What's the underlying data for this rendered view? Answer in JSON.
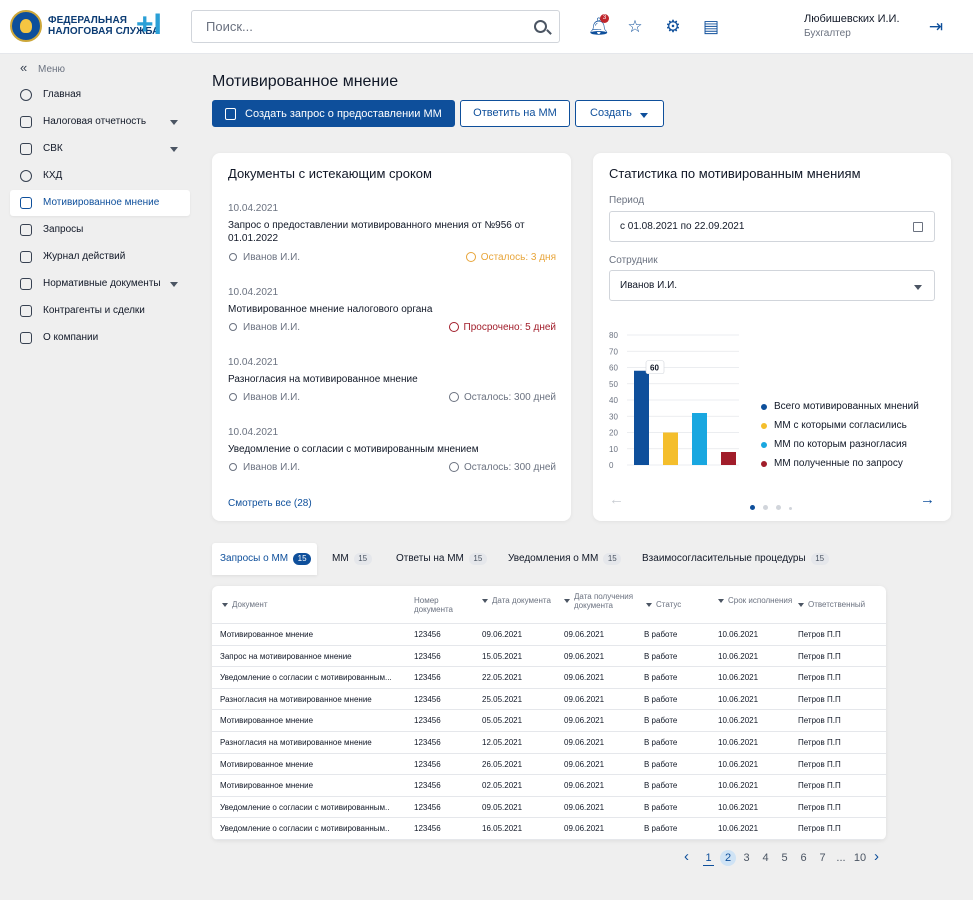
{
  "header": {
    "logo_line1": "ФЕДЕРАЛЬНАЯ",
    "logo_line2": "НАЛОГОВАЯ СЛУЖБА",
    "logo_plus": "+I",
    "search_placeholder": "Поиск...",
    "notifications_count": "3",
    "user_name": "Любишевских И.И.",
    "user_role": "Бухгалтер"
  },
  "sidebar": {
    "menu_label": "Меню",
    "items": [
      {
        "label": "Главная",
        "icon": "home-icon",
        "has_caret": false
      },
      {
        "label": "Налоговая отчетность",
        "icon": "report-icon",
        "has_caret": true
      },
      {
        "label": "СВК",
        "icon": "svk-icon",
        "has_caret": true
      },
      {
        "label": "КХД",
        "icon": "database-icon",
        "has_caret": false
      },
      {
        "label": "Мотивированное мнение",
        "icon": "opinion-icon",
        "has_caret": false
      },
      {
        "label": "Запросы",
        "icon": "inbox-icon",
        "has_caret": false
      },
      {
        "label": "Журнал действий",
        "icon": "journal-icon",
        "has_caret": false
      },
      {
        "label": "Нормативные документы",
        "icon": "docs-icon",
        "has_caret": true
      },
      {
        "label": "Контрагенты и сделки",
        "icon": "contractors-icon",
        "has_caret": false
      },
      {
        "label": "О компании",
        "icon": "info-icon",
        "has_caret": false
      }
    ],
    "active_index": 4
  },
  "page": {
    "title": "Мотивированное мнение",
    "btn_create_request": "Создать запрос о предоставлении ММ",
    "btn_reply": "Ответить на ММ",
    "btn_create": "Создать"
  },
  "expiring": {
    "title": "Документы с истекающим сроком",
    "docs": [
      {
        "date": "10.04.2021",
        "title": "Запрос о предоставлении мотивированного мнения от №956 от 01.01.2022",
        "person": "Иванов И.И.",
        "status": "Осталось: 3 дня",
        "kind": "warn"
      },
      {
        "date": "10.04.2021",
        "title": "Мотивированное мнение налогового органа",
        "person": "Иванов И.И.",
        "status": "Просрочено: 5 дней",
        "kind": "late"
      },
      {
        "date": "10.04.2021",
        "title": "Разногласия на мотивированное мнение",
        "person": "Иванов И.И.",
        "status": "Осталось: 300 дней",
        "kind": "ok"
      },
      {
        "date": "10.04.2021",
        "title": "Уведомление о согласии с мотивированным мнением",
        "person": "Иванов И.И.",
        "status": "Осталось: 300 дней",
        "kind": "ok"
      }
    ],
    "see_all": "Смотреть все (28)"
  },
  "stats": {
    "title": "Статистика по мотивированным мнениям",
    "period_label": "Период",
    "period_value": "с 01.08.2021 по  22.09.2021",
    "employee_label": "Сотрудник",
    "employee_value": "Иванов И.И.",
    "tooltip_value": "60"
  },
  "chart_data": {
    "type": "bar",
    "categories": [
      "Всего мотивированных мнений",
      "ММ с которыми согласились",
      "ММ по которым разногласия",
      "ММ полученные по запросу"
    ],
    "values": [
      58,
      20,
      32,
      8
    ],
    "colors": [
      "#0e4f9b",
      "#f4be2c",
      "#19a7e0",
      "#a11d2a"
    ],
    "yticks": [
      0,
      10,
      20,
      30,
      40,
      50,
      60,
      70,
      80
    ],
    "ylim": [
      0,
      80
    ],
    "legend_placement": "right",
    "grid": true
  },
  "tabs": [
    {
      "label": "Запросы о ММ",
      "count": "15"
    },
    {
      "label": "ММ",
      "count": "15"
    },
    {
      "label": "Ответы на ММ",
      "count": "15"
    },
    {
      "label": "Уведомления о ММ",
      "count": "15"
    },
    {
      "label": "Взаимосогласительные процедуры",
      "count": "15"
    }
  ],
  "table": {
    "headers": [
      "Документ",
      "Номер документа",
      "Дата документа",
      "Дата получения документа",
      "Статус",
      "Срок исполнения",
      "Ответственный"
    ],
    "rows": [
      [
        "Мотивированное мнение",
        "123456",
        "09.06.2021",
        "09.06.2021",
        "В работе",
        "10.06.2021",
        "Петров П.П"
      ],
      [
        "Запрос на мотивированное мнение",
        "123456",
        "15.05.2021",
        "09.06.2021",
        "В работе",
        "10.06.2021",
        "Петров П.П"
      ],
      [
        "Уведомление о согласии с мотивированным...",
        "123456",
        "22.05.2021",
        "09.06.2021",
        "В работе",
        "10.06.2021",
        "Петров П.П"
      ],
      [
        "Разногласия на мотивированное мнение",
        "123456",
        "25.05.2021",
        "09.06.2021",
        "В работе",
        "10.06.2021",
        "Петров П.П"
      ],
      [
        "Мотивированное мнение",
        "123456",
        "05.05.2021",
        "09.06.2021",
        "В работе",
        "10.06.2021",
        "Петров П.П"
      ],
      [
        "Разногласия на мотивированное мнение",
        "123456",
        "12.05.2021",
        "09.06.2021",
        "В работе",
        "10.06.2021",
        "Петров П.П"
      ],
      [
        "Мотивированное мнение",
        "123456",
        "26.05.2021",
        "09.06.2021",
        "В работе",
        "10.06.2021",
        "Петров П.П"
      ],
      [
        "Мотивированное мнение",
        "123456",
        "02.05.2021",
        "09.06.2021",
        "В работе",
        "10.06.2021",
        "Петров П.П"
      ],
      [
        "Уведомление о согласии с мотивированным..",
        "123456",
        "09.05.2021",
        "09.06.2021",
        "В работе",
        "10.06.2021",
        "Петров П.П"
      ],
      [
        "Уведомление о согласии с мотивированным..",
        "123456",
        "16.05.2021",
        "09.06.2021",
        "В работе",
        "10.06.2021",
        "Петров П.П"
      ]
    ]
  },
  "pagination": {
    "pages": [
      "1",
      "2",
      "3",
      "4",
      "5",
      "6",
      "7",
      "...",
      "10"
    ],
    "current": "1",
    "highlighted": "2"
  }
}
